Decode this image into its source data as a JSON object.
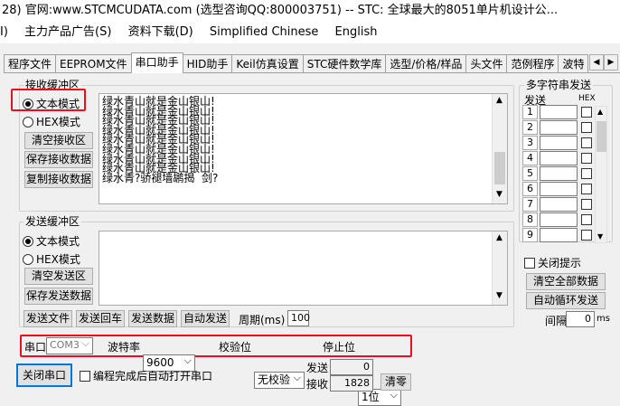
{
  "title": "28) 官网:www.STCMCUDATA.com (选型咨询QQ:800003751) -- STC: 全球最大的8051单片机设计公...",
  "menu": [
    "I)",
    "主力产品广告(S)",
    "资料下载(D)",
    "Simplified Chinese",
    "English"
  ],
  "tabs": [
    "程序文件",
    "EEPROM文件",
    "串口助手",
    "HID助手",
    "Keil仿真设置",
    "STC硬件数学库",
    "选型/价格/样品",
    "头文件",
    "范例程序",
    "波特"
  ],
  "active_tab": 2,
  "recv": {
    "label": "接收缓冲区",
    "text_mode": "文本模式",
    "hex_mode": "HEX模式",
    "clear_btn": "清空接收区",
    "save_btn": "保存接收数据",
    "copy_btn": "复制接收数据",
    "lines": [
      "绿水青山就是金山银山!",
      "绿水青山就是金山银山!",
      "绿水青山就是金山银山!",
      "绿水青山就是金山银山!",
      "绿水青山就是金山银山!",
      "绿水青山就是金山银山!",
      "绿水青山就是金山银山!",
      "绿水青山就是金山银山!",
      "绿水青?骄褪墙鹕揭  剑?"
    ]
  },
  "send": {
    "label": "发送缓冲区",
    "text_mode": "文本模式",
    "hex_mode": "HEX模式",
    "clear_btn": "清空发送区",
    "save_btn": "保存发送数据",
    "send_file": "发送文件",
    "send_return": "发送回车",
    "send_data": "发送数据",
    "auto_send": "自动发送",
    "period_label": "周期(ms)",
    "period_value": "100"
  },
  "multi": {
    "label": "多字符串发送",
    "col_send": "发送",
    "col_hex": "HEX",
    "rows": [
      "1",
      "2",
      "3",
      "4",
      "5",
      "6",
      "7",
      "8",
      "9"
    ],
    "close_hint": "关闭提示",
    "clear_all": "清空全部数据",
    "auto_loop": "自动循环发送",
    "interval_label": "间隔",
    "interval_value": "0",
    "interval_unit": "ms"
  },
  "settings": {
    "port_label": "串口",
    "port_value": "COM3",
    "baud_label": "波特率",
    "baud_value": "9600",
    "parity_label": "校验位",
    "parity_value": "无校验",
    "stop_label": "停止位",
    "stop_value": "1位"
  },
  "bottom": {
    "close_port": "关闭串口",
    "auto_open": "编程完成后自动打开串口",
    "sent_label": "发送",
    "sent_value": "0",
    "recv_label": "接收",
    "recv_value": "1828",
    "clear_btn": "清零"
  },
  "colors": {
    "highlight": "#e8101b",
    "focus": "#0078d7"
  }
}
